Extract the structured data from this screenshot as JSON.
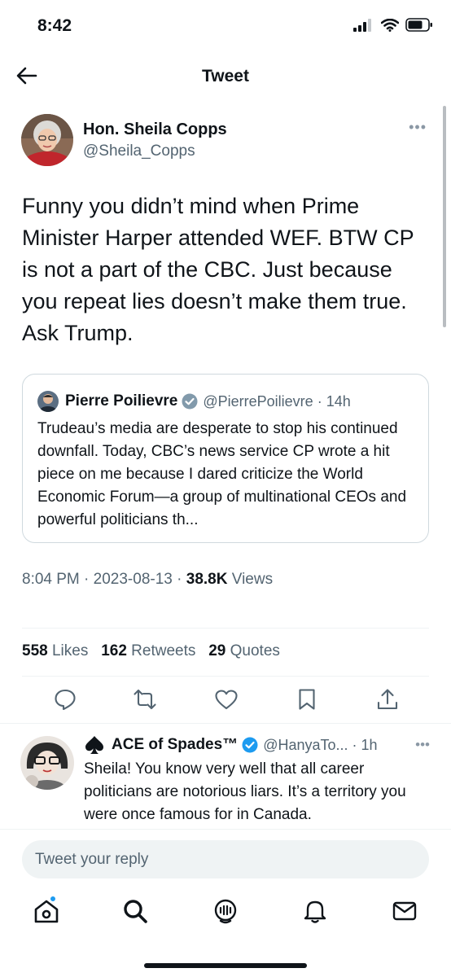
{
  "status_bar": {
    "time": "8:42"
  },
  "nav": {
    "title": "Tweet"
  },
  "tweet": {
    "author_name": "Hon. Sheila Copps",
    "author_handle": "@Sheila_Copps",
    "text": "Funny you didn’t mind when Prime Minister Harper attended WEF. BTW CP is not a part of the CBC. Just because you repeat lies doesn’t make them true. Ask Trump.",
    "time": "8:04 PM",
    "date": "2023-08-13",
    "views_count": "38.8K",
    "views_label": "Views",
    "sep": "·"
  },
  "quote": {
    "name": "Pierre Poilievre",
    "handle_time": "@PierrePoilievre · 14h",
    "text": "Trudeau’s media are desperate to stop his continued downfall. Today, CBC’s news service CP wrote a hit piece on me because I dared criticize the World Economic Forum—a group of multinational CEOs and powerful politicians th..."
  },
  "stats": {
    "likes_count": "558",
    "likes_label": "Likes",
    "retweets_count": "162",
    "retweets_label": "Retweets",
    "quotes_count": "29",
    "quotes_label": "Quotes"
  },
  "reply": {
    "name": "ACE of Spades™",
    "handle_time": "@HanyaTo... · 1h",
    "text": "Sheila! You know very well that all career politicians are notorious liars. It’s a territory you were once famous for in Canada."
  },
  "reply_input": {
    "placeholder": "Tweet your reply"
  },
  "colors": {
    "accent": "#1d9bf0",
    "text": "#0f1419",
    "secondary": "#536471"
  }
}
